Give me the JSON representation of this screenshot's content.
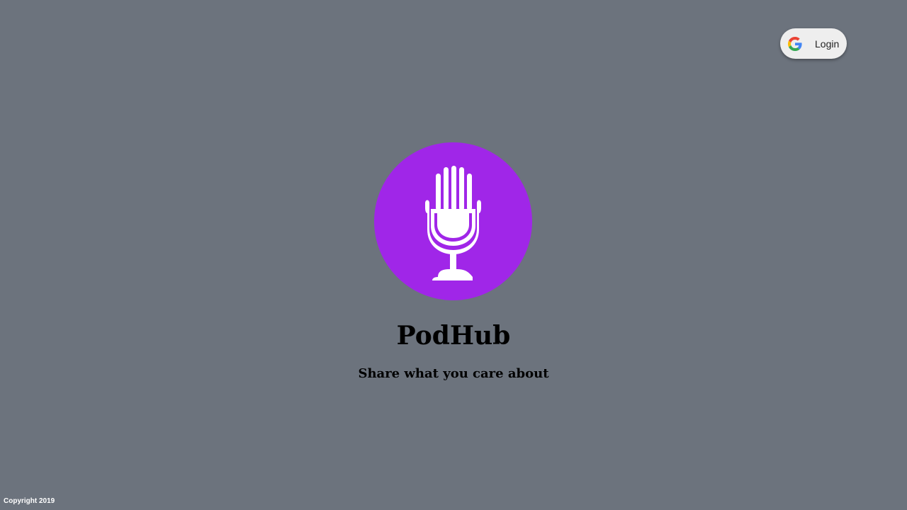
{
  "header": {
    "login_label": "Login",
    "login_icon": "google-icon"
  },
  "hero": {
    "logo_icon": "microphone-icon",
    "logo_color": "#a026e8",
    "title": "PodHub",
    "tagline": "Share what you care about"
  },
  "footer": {
    "copyright": "Copyright 2019"
  },
  "colors": {
    "background": "#6c737d",
    "accent": "#a026e8",
    "button_bg": "#eeeeee"
  }
}
